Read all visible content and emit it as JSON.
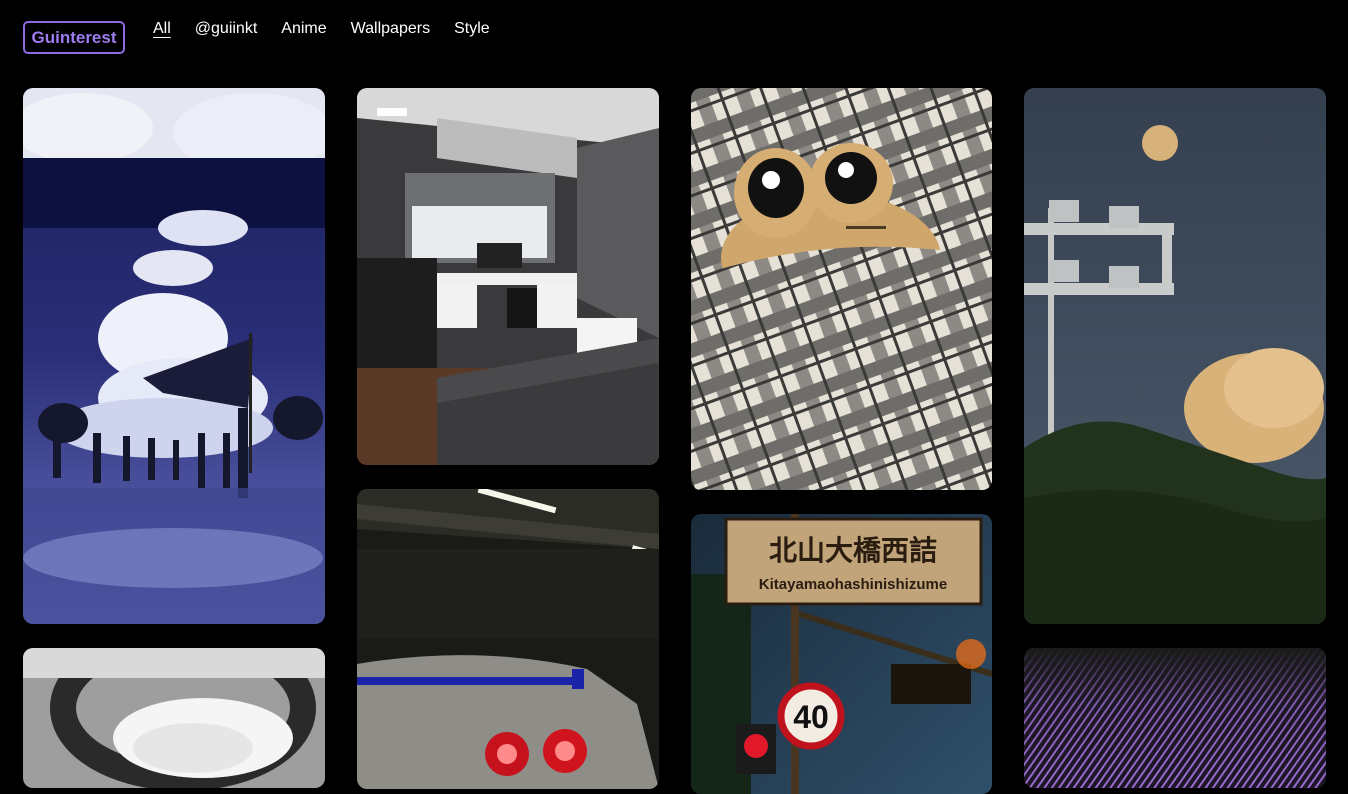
{
  "brand": {
    "logo_text": "Guinterest",
    "accent": "#8e6be0"
  },
  "nav": {
    "items": [
      {
        "label": "All",
        "active": true
      },
      {
        "label": "@guiinkt",
        "active": false
      },
      {
        "label": "Anime",
        "active": false
      },
      {
        "label": "Wallpapers",
        "active": false
      },
      {
        "label": "Style",
        "active": false
      }
    ]
  },
  "pins": {
    "sign_text_jp": "北山大橋西詰",
    "sign_text_romaji": "Kitayamaohashinishizume",
    "speed_limit": "40"
  }
}
